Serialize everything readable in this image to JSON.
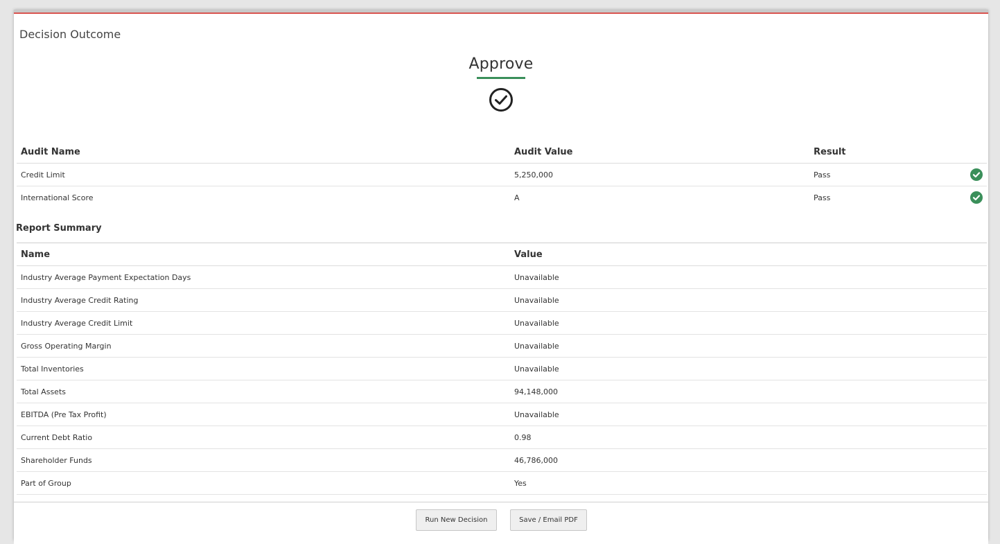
{
  "panel": {
    "title": "Decision Outcome"
  },
  "outcome": {
    "label": "Approve",
    "icon": "check-circle-icon",
    "accent_color": "#3a8f5a"
  },
  "audit": {
    "headers": {
      "name": "Audit Name",
      "value": "Audit Value",
      "result": "Result"
    },
    "rows": [
      {
        "name": "Credit Limit",
        "value": "5,250,000",
        "result": "Pass",
        "icon": "pass-check-icon"
      },
      {
        "name": "International Score",
        "value": "A",
        "result": "Pass",
        "icon": "pass-check-icon"
      }
    ],
    "pass_color": "#3a8f5a"
  },
  "summary": {
    "heading": "Report Summary",
    "headers": {
      "name": "Name",
      "value": "Value"
    },
    "rows": [
      {
        "name": "Industry Average Payment Expectation Days",
        "value": "Unavailable"
      },
      {
        "name": "Industry Average Credit Rating",
        "value": "Unavailable"
      },
      {
        "name": "Industry Average Credit Limit",
        "value": "Unavailable"
      },
      {
        "name": "Gross Operating Margin",
        "value": "Unavailable"
      },
      {
        "name": "Total Inventories",
        "value": "Unavailable"
      },
      {
        "name": "Total Assets",
        "value": "94,148,000"
      },
      {
        "name": "EBITDA (Pre Tax Profit)",
        "value": "Unavailable"
      },
      {
        "name": "Current Debt Ratio",
        "value": "0.98"
      },
      {
        "name": "Shareholder Funds",
        "value": "46,786,000"
      },
      {
        "name": "Part of Group",
        "value": "Yes"
      }
    ]
  },
  "actions": {
    "run_new": "Run New Decision",
    "save_email": "Save / Email PDF"
  }
}
